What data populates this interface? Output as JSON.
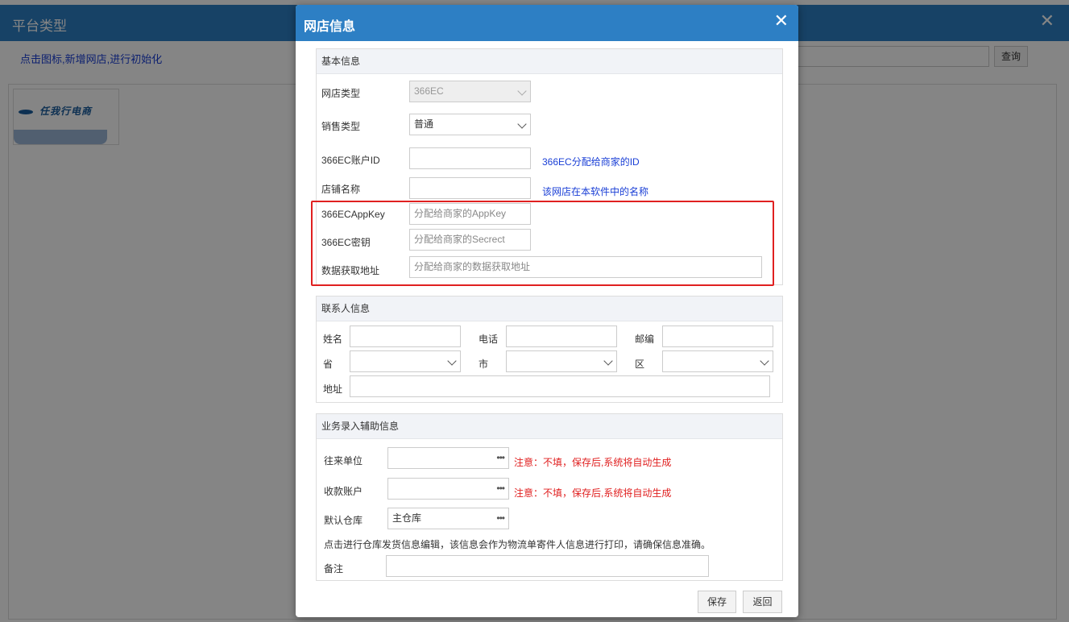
{
  "background": {
    "title": "平台类型",
    "hint": "点击图标,新增网店,进行初始化",
    "query_label": "查询",
    "tile_logo_text": "任我行电商",
    "close_glyph": "✕"
  },
  "modal": {
    "title": "网店信息",
    "close_glyph": "✕",
    "basic": {
      "header": "基本信息",
      "shop_type_label": "网店类型",
      "shop_type_value": "366EC",
      "sale_type_label": "销售类型",
      "sale_type_value": "普通",
      "account_id_label": "366EC账户ID",
      "account_id_value": "",
      "account_id_note": "366EC分配给商家的ID",
      "shop_name_label": "店铺名称",
      "shop_name_value": "",
      "shop_name_note": "该网店在本软件中的名称",
      "appkey_label": "366ECAppKey",
      "appkey_placeholder": "分配给商家的AppKey",
      "secret_label": "366EC密钥",
      "secret_placeholder": "分配给商家的Secrect",
      "url_label": "数据获取地址",
      "url_placeholder": "分配给商家的数据获取地址"
    },
    "contact": {
      "header": "联系人信息",
      "name_label": "姓名",
      "phone_label": "电话",
      "zip_label": "邮编",
      "province_label": "省",
      "city_label": "市",
      "district_label": "区",
      "address_label": "地址"
    },
    "business": {
      "header": "业务录入辅助信息",
      "partner_label": "往来单位",
      "partner_note": "注意：不填，保存后,系统将自动生成",
      "account_label": "收款账户",
      "account_note": "注意：不填，保存后,系统将自动生成",
      "warehouse_label": "默认仓库",
      "warehouse_value": "主仓库",
      "dots": "•••",
      "warehouse_hint": "点击进行仓库发货信息编辑，该信息会作为物流单寄件人信息进行打印，请确保信息准确。",
      "remark_label": "备注"
    },
    "footer": {
      "save_label": "保存",
      "back_label": "返回"
    }
  }
}
